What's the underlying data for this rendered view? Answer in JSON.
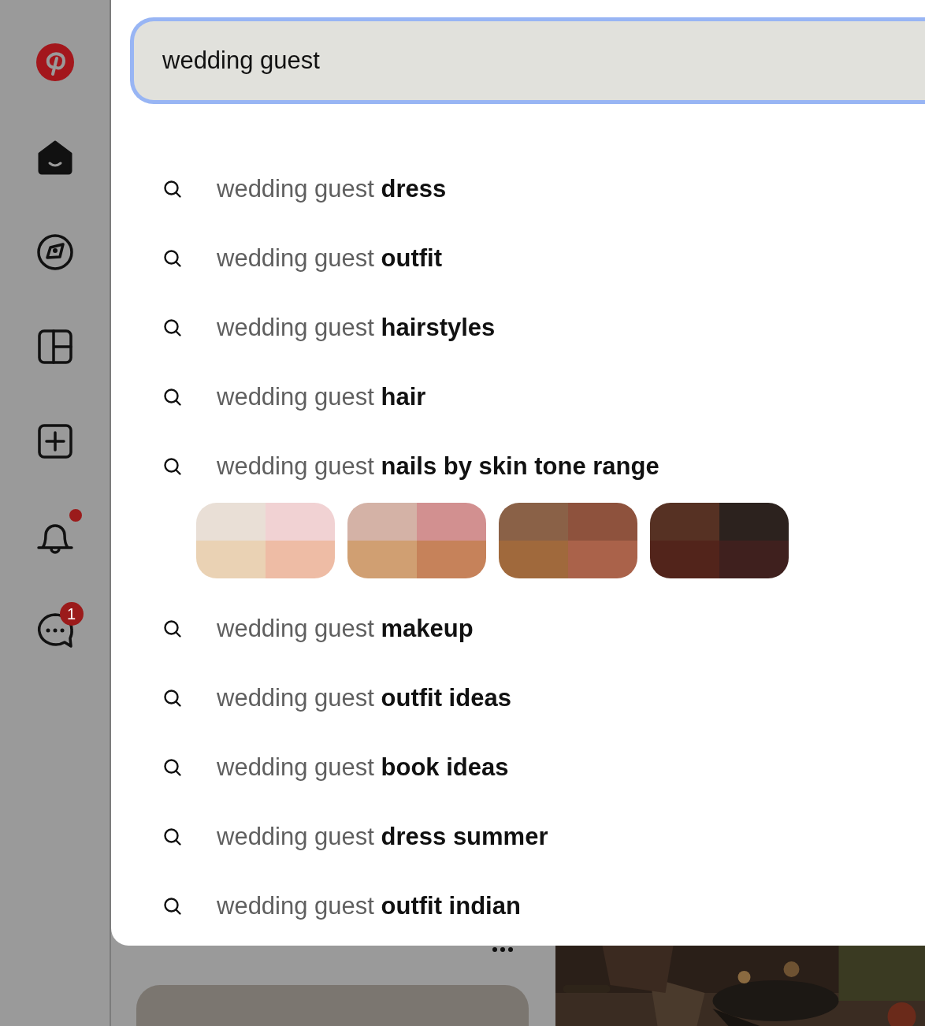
{
  "sidebar": {
    "items": [
      {
        "kind": "logo"
      },
      {
        "kind": "home",
        "selected": true
      },
      {
        "kind": "explore",
        "selected": false
      },
      {
        "kind": "boards",
        "selected": false
      },
      {
        "kind": "create",
        "selected": false
      },
      {
        "kind": "notifications",
        "selected": false,
        "unread": true
      },
      {
        "kind": "messages",
        "selected": false,
        "badge": "1"
      }
    ]
  },
  "search": {
    "value": "wedding guest"
  },
  "suggestions": [
    {
      "kind": "query",
      "text": "wedding guest **dress**"
    },
    {
      "kind": "query",
      "text": "wedding guest **outfit**"
    },
    {
      "kind": "query",
      "text": "wedding guest **hairstyles**"
    },
    {
      "kind": "query",
      "text": "wedding guest **hair**"
    },
    {
      "kind": "query",
      "text": "wedding guest **nails by skin tone range**"
    },
    {
      "kind": "swatches",
      "swatches": [
        {
          "cells": [
            {
              "color": "#e9dfd6"
            },
            {
              "color": "#f1d2d3"
            },
            {
              "color": "#ead2b4"
            },
            {
              "color": "#eebca5"
            }
          ]
        },
        {
          "cells": [
            {
              "color": "#d4b2a6"
            },
            {
              "color": "#d29090"
            },
            {
              "color": "#d09f72"
            },
            {
              "color": "#c6825a"
            }
          ]
        },
        {
          "cells": [
            {
              "color": "#8a6147"
            },
            {
              "color": "#8e523d"
            },
            {
              "color": "#a0693c"
            },
            {
              "color": "#aa624a"
            }
          ]
        },
        {
          "cells": [
            {
              "color": "#563123"
            },
            {
              "color": "#2c221e"
            },
            {
              "color": "#52241b"
            },
            {
              "color": "#3f201e"
            }
          ]
        }
      ]
    },
    {
      "kind": "query",
      "text": "wedding guest **makeup**"
    },
    {
      "kind": "query",
      "text": "wedding guest **outfit ideas**"
    },
    {
      "kind": "query",
      "text": "wedding guest **book ideas**"
    },
    {
      "kind": "query",
      "text": "wedding guest **dress summer**"
    },
    {
      "kind": "query",
      "text": "wedding guest **outfit indian**"
    }
  ]
}
